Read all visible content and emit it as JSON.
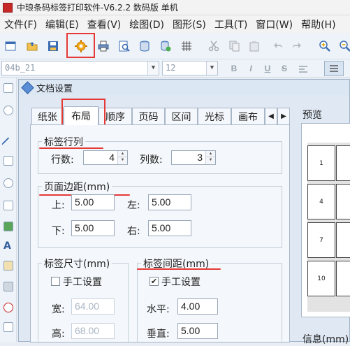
{
  "window": {
    "title": "中琅条码标签打印软件-V6.2.2 数码版 单机"
  },
  "menu": {
    "items": [
      {
        "label": "文件(F)"
      },
      {
        "label": "编辑(E)"
      },
      {
        "label": "查看(V)"
      },
      {
        "label": "绘图(D)"
      },
      {
        "label": "图形(S)"
      },
      {
        "label": "工具(T)"
      },
      {
        "label": "窗口(W)"
      },
      {
        "label": "帮助(H)"
      }
    ]
  },
  "toolbar": {
    "icons": [
      "new-icon",
      "open-icon",
      "save-icon",
      "settings-gear-icon",
      "print-icon",
      "print-preview-icon",
      "database-icon",
      "database-settings-icon",
      "grid-icon",
      "cut-icon",
      "copy-icon",
      "paste-icon",
      "undo-icon",
      "redo-icon",
      "zoom-in-icon",
      "zoom-out-icon"
    ],
    "highlighted": "settings-gear-icon"
  },
  "fontbar": {
    "font_name": "04b_21",
    "font_size": "12",
    "bold": "B",
    "italic": "I",
    "underline": "U",
    "strike": "S"
  },
  "dialog": {
    "title": "文档设置",
    "tabs": [
      {
        "label": "纸张"
      },
      {
        "label": "布局"
      },
      {
        "label": "顺序"
      },
      {
        "label": "页码"
      },
      {
        "label": "区间"
      },
      {
        "label": "光标"
      },
      {
        "label": "画布"
      }
    ],
    "active_tab": "布局",
    "rows_cols": {
      "title": "标签行列",
      "rows_label": "行数:",
      "rows_value": "4",
      "cols_label": "列数:",
      "cols_value": "3"
    },
    "margins": {
      "title": "页面边距(mm)",
      "top_label": "上:",
      "top_value": "5.00",
      "left_label": "左:",
      "left_value": "5.00",
      "bottom_label": "下:",
      "bottom_value": "5.00",
      "right_label": "右:",
      "right_value": "5.00"
    },
    "label_size": {
      "title": "标签尺寸(mm)",
      "manual_label": "手工设置",
      "manual_checked": false,
      "width_label": "宽:",
      "width_value": "64.00",
      "height_label": "高:",
      "height_value": "68.00"
    },
    "label_spacing": {
      "title": "标签间距(mm)",
      "manual_label": "手工设置",
      "manual_checked": true,
      "horizontal_label": "水平:",
      "horizontal_value": "4.00",
      "vertical_label": "垂直:",
      "vertical_value": "5.00"
    },
    "preview": {
      "title": "预览",
      "labels": [
        "1",
        "4",
        "7",
        "10"
      ],
      "info_title": "信息(mm)"
    }
  }
}
